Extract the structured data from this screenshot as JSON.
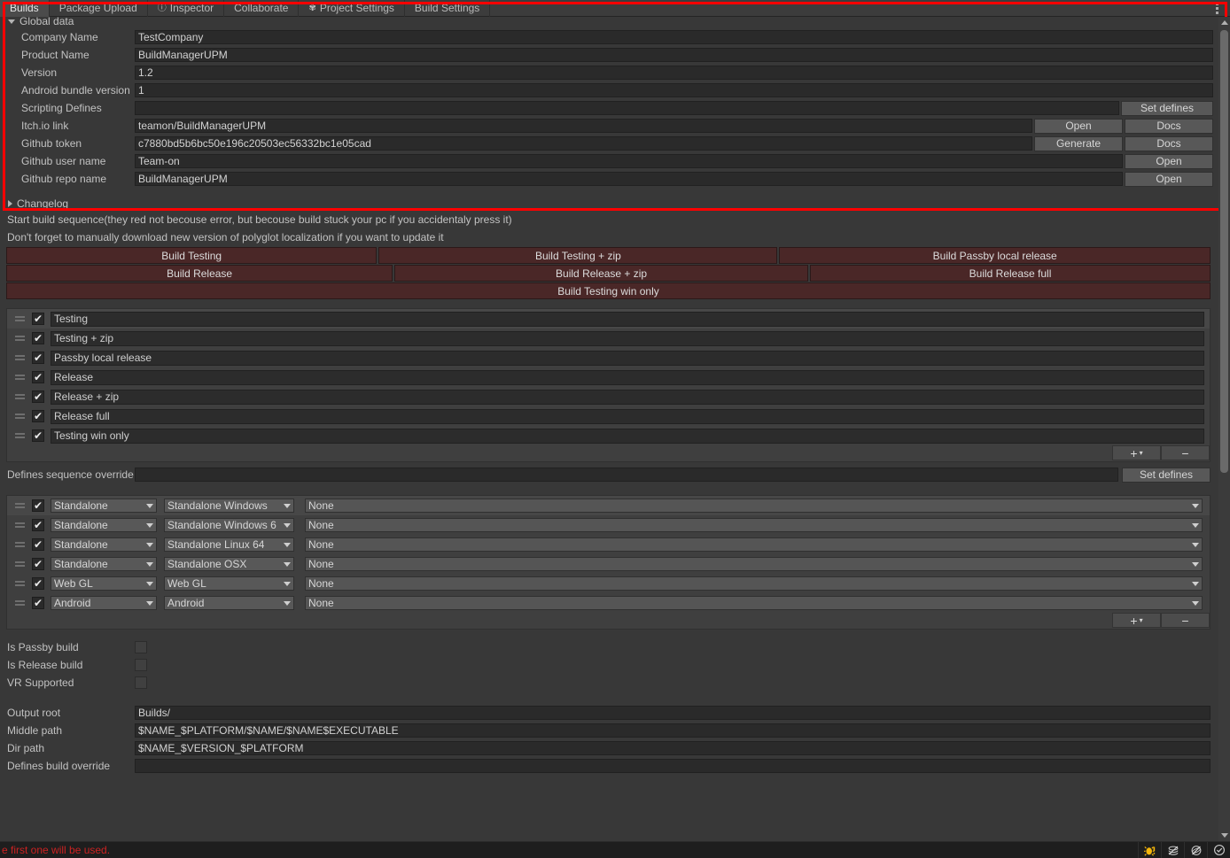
{
  "tabs": [
    {
      "label": "Builds",
      "icon": null,
      "active": true
    },
    {
      "label": "Package Upload",
      "icon": null,
      "active": false
    },
    {
      "label": "Inspector",
      "icon": "info-icon",
      "active": false
    },
    {
      "label": "Collaborate",
      "icon": null,
      "active": false
    },
    {
      "label": "Project Settings",
      "icon": "gear-icon",
      "active": false
    },
    {
      "label": "Build Settings",
      "icon": null,
      "active": false
    }
  ],
  "global_data": {
    "section_title": "Global data",
    "rows": [
      {
        "label": "Company Name",
        "value": "TestCompany",
        "buttons": []
      },
      {
        "label": "Product Name",
        "value": "BuildManagerUPM",
        "buttons": []
      },
      {
        "label": "Version",
        "value": "1.2",
        "buttons": []
      },
      {
        "label": "Android bundle version",
        "value": "1",
        "buttons": []
      },
      {
        "label": "Scripting Defines",
        "value": "",
        "buttons": [
          "Set defines"
        ]
      },
      {
        "label": "Itch.io link",
        "value": "teamon/BuildManagerUPM",
        "buttons": [
          "Open",
          "Docs"
        ]
      },
      {
        "label": "Github token",
        "value": "c7880bd5b6bc50e196c20503ec56332bc1e05cad",
        "buttons": [
          "Generate",
          "Docs"
        ]
      },
      {
        "label": "Github user name",
        "value": "Team-on",
        "buttons": [
          "Open"
        ]
      },
      {
        "label": "Github repo name",
        "value": "BuildManagerUPM",
        "buttons": [
          "Open"
        ]
      }
    ]
  },
  "changelog": {
    "label": "Changelog"
  },
  "notes": [
    "Start build sequence(they red not becouse error, but becouse build stuck your pc if you accidentaly press it)",
    "Don't forget to manually download new version of polyglot localization if you want to update it"
  ],
  "build_buttons": {
    "row1": [
      "Build Testing",
      "Build Testing + zip",
      "Build Passby local release"
    ],
    "row2": [
      "Build Release",
      "Build Release + zip",
      "Build Release full"
    ],
    "row3": [
      "Build Testing win only"
    ]
  },
  "sequence_list": {
    "items": [
      {
        "name": "Testing",
        "enabled": true
      },
      {
        "name": "Testing + zip",
        "enabled": true
      },
      {
        "name": "Passby local release",
        "enabled": true
      },
      {
        "name": "Release",
        "enabled": true
      },
      {
        "name": "Release + zip",
        "enabled": true
      },
      {
        "name": "Release full",
        "enabled": true
      },
      {
        "name": "Testing win only",
        "enabled": true
      }
    ],
    "add_label": "+",
    "remove_label": "−"
  },
  "defines_override": {
    "label": "Defines sequence override",
    "value": "",
    "button": "Set defines"
  },
  "platform_list": {
    "rows": [
      {
        "enabled": true,
        "group": "Standalone",
        "target": "Standalone Windows",
        "sub": "None"
      },
      {
        "enabled": true,
        "group": "Standalone",
        "target": "Standalone Windows 6",
        "sub": "None"
      },
      {
        "enabled": true,
        "group": "Standalone",
        "target": "Standalone Linux 64",
        "sub": "None"
      },
      {
        "enabled": true,
        "group": "Standalone",
        "target": "Standalone OSX",
        "sub": "None"
      },
      {
        "enabled": true,
        "group": "Web GL",
        "target": "Web GL",
        "sub": "None"
      },
      {
        "enabled": true,
        "group": "Android",
        "target": "Android",
        "sub": "None"
      }
    ],
    "add_label": "+",
    "remove_label": "−"
  },
  "flags": [
    {
      "label": "Is Passby build",
      "checked": false
    },
    {
      "label": "Is Release build",
      "checked": false
    },
    {
      "label": "VR Supported",
      "checked": false
    }
  ],
  "paths": [
    {
      "label": "Output root",
      "value": "Builds/"
    },
    {
      "label": "Middle path",
      "value": "$NAME_$PLATFORM/$NAME/$NAME$EXECUTABLE"
    },
    {
      "label": "Dir path",
      "value": "$NAME_$VERSION_$PLATFORM"
    },
    {
      "label": "Defines build override",
      "value": ""
    }
  ],
  "status_bar": {
    "message": "e first one will be used.",
    "icons": [
      "bug-icon",
      "layers-icon",
      "no-sound-icon",
      "check-circle-icon"
    ]
  },
  "colors": {
    "red_outline": "#ff0000",
    "build_button": "#4a2727",
    "error_text": "#cc2222",
    "panel_bg": "#383838"
  }
}
